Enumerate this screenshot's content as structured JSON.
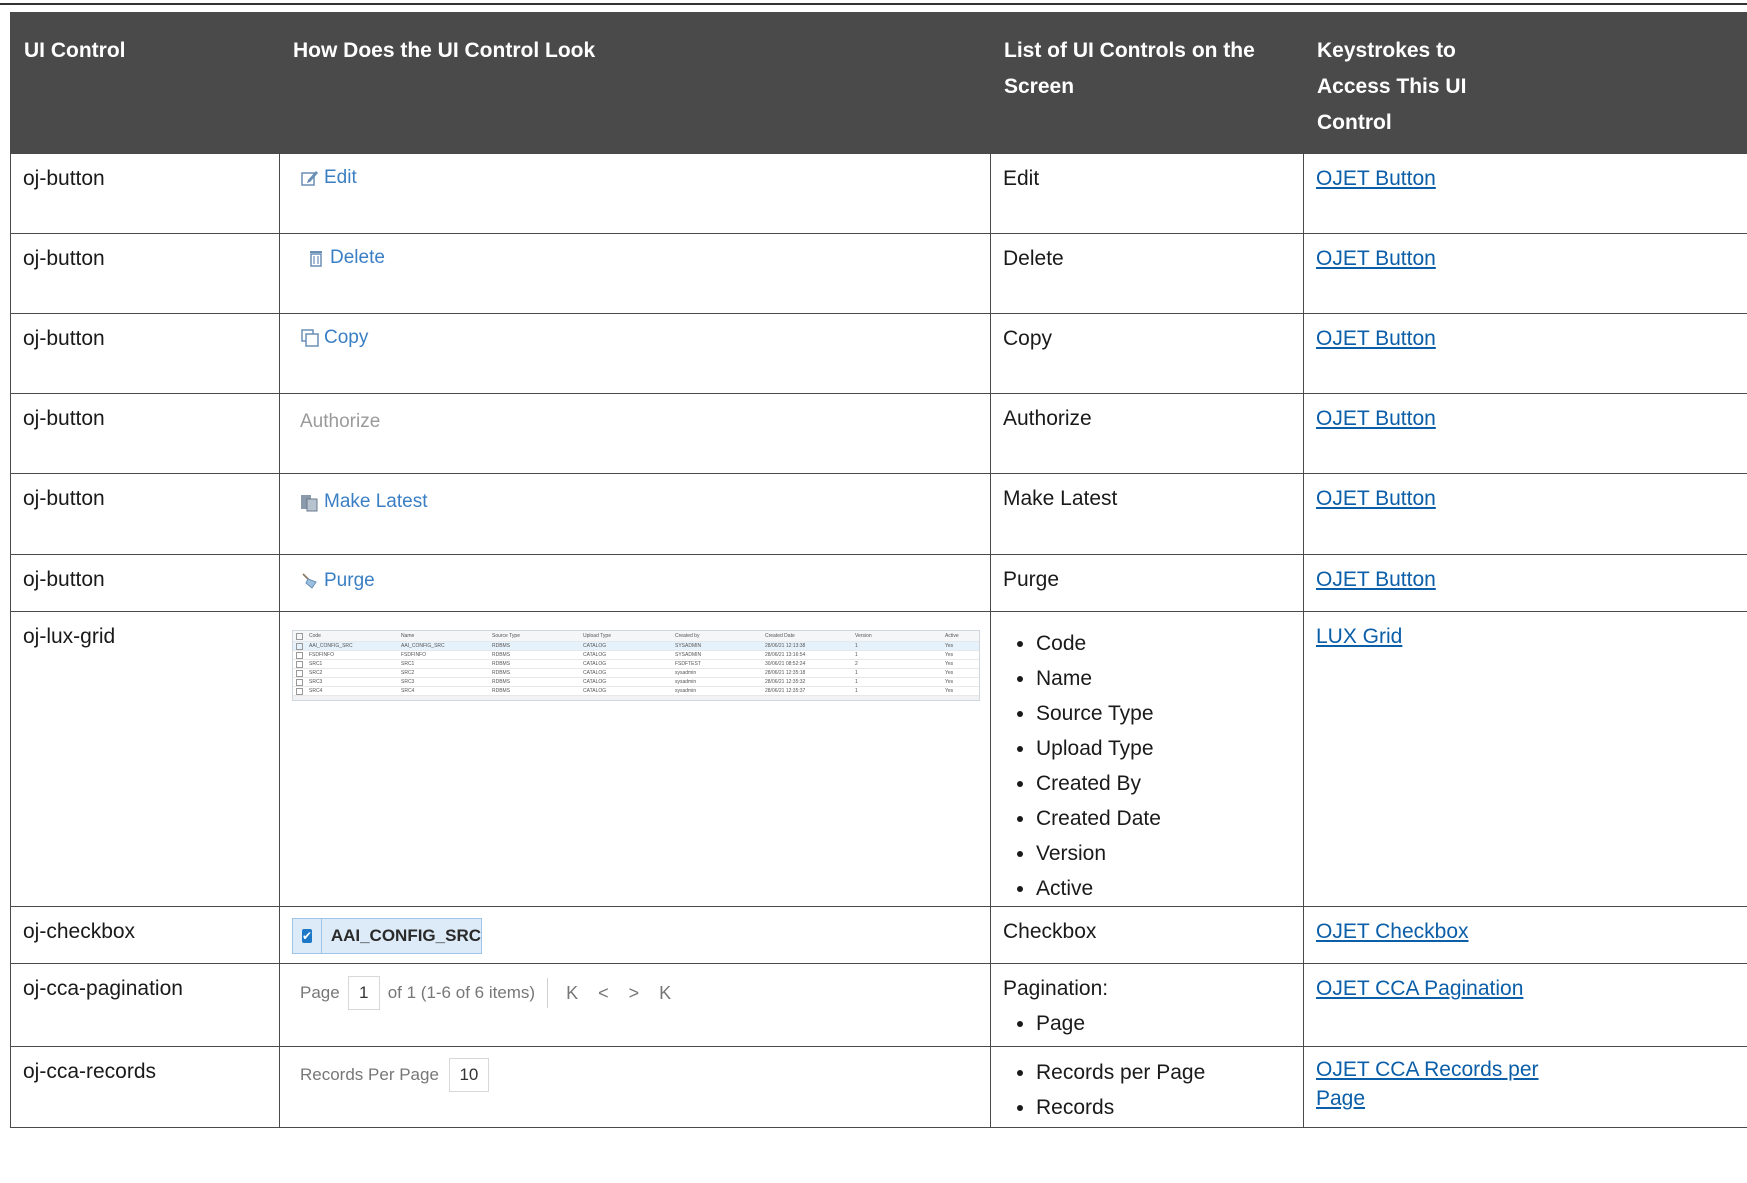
{
  "headers": {
    "c1": "UI Control",
    "c2": "How Does the UI Control Look",
    "c3": "List of UI Controls on the Screen",
    "c4": "Keystrokes to Access This UI Control"
  },
  "rows": [
    {
      "control": "oj-button",
      "look": "Edit",
      "list": "Edit",
      "link": "OJET Button",
      "icon": "edit-icon"
    },
    {
      "control": "oj-button",
      "look": "Delete",
      "list": "Delete",
      "link": "OJET Button",
      "icon": "trash-icon"
    },
    {
      "control": "oj-button",
      "look": "Copy",
      "list": "Copy",
      "link": "OJET Button",
      "icon": "copy-icon"
    },
    {
      "control": "oj-button",
      "look": "Authorize",
      "list": "Authorize",
      "link": "OJET Button"
    },
    {
      "control": "oj-button",
      "look": "Make Latest",
      "list": "Make Latest",
      "link": "OJET Button",
      "icon": "make-latest-icon"
    },
    {
      "control": "oj-button",
      "look": "Purge",
      "list": "Purge",
      "link": "OJET Button",
      "icon": "purge-icon"
    },
    {
      "control": "oj-lux-grid",
      "list_items": [
        "Code",
        "Name",
        "Source Type",
        "Upload Type",
        "Created By",
        "Created Date",
        "Version",
        "Active"
      ],
      "link": "LUX Grid"
    },
    {
      "control": "oj-checkbox",
      "look": "AAI_CONFIG_SRC",
      "list": "Checkbox",
      "link": "OJET Checkbox"
    },
    {
      "control": "oj-cca-pagination",
      "list": "Pagination:",
      "list_items": [
        "Page"
      ],
      "link": "OJET CCA Pagination",
      "look": {
        "page_label": "Page",
        "page_value": "1",
        "of_text": "of 1 (1-6 of 6 items)",
        "nav": [
          "K",
          "<",
          ">",
          "K"
        ]
      }
    },
    {
      "control": "oj-cca-records",
      "list_items": [
        "Records per Page",
        "Records"
      ],
      "link": "OJET CCA Records per Page",
      "look": {
        "label": "Records Per Page",
        "value": "10"
      }
    }
  ],
  "grid_preview": {
    "columns": [
      "Code",
      "Name",
      "Source Type",
      "Upload Type",
      "Created by",
      "Created Date",
      "Version",
      "Active"
    ],
    "rows": [
      [
        "AAI_CONFIG_SRC",
        "AAI_CONFIG_SRC",
        "RDBMS",
        "CATALOG",
        "SYSADMIN",
        "28/06/21 12:13:38",
        "1",
        "Yes"
      ],
      [
        "FSDFINFO",
        "FSDFINFO",
        "RDBMS",
        "CATALOG",
        "SYSADMIN",
        "28/06/21 13:16:54",
        "1",
        "Yes"
      ],
      [
        "SRC1",
        "SRC1",
        "RDBMS",
        "CATALOG",
        "FSDFTEST",
        "30/06/21 08:52:24",
        "2",
        "Yes"
      ],
      [
        "SRC2",
        "SRC2",
        "RDBMS",
        "CATALOG",
        "sysadmin",
        "28/06/21 12:35:18",
        "1",
        "Yes"
      ],
      [
        "SRC3",
        "SRC3",
        "RDBMS",
        "CATALOG",
        "sysadmin",
        "28/06/21 12:35:32",
        "1",
        "Yes"
      ],
      [
        "SRC4",
        "SRC4",
        "RDBMS",
        "CATALOG",
        "sysadmin",
        "28/06/21 12:35:37",
        "1",
        "Yes"
      ]
    ]
  },
  "colors": {
    "header_bg": "#4a4a4a",
    "link": "#0b5ea8",
    "button_blue": "#3a7fc4"
  }
}
